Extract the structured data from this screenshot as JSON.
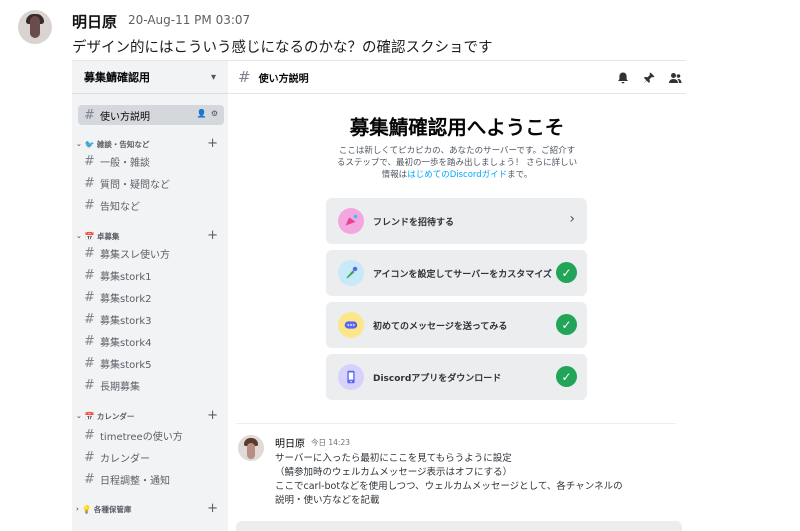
{
  "outer_message": {
    "author": "明日原",
    "timestamp": "20-Aug-11 PM 03:07",
    "text": "デザイン的にはこういう感じになるのかな？の確認スクショです"
  },
  "sidebar": {
    "server_name": "募集鯖確認用",
    "top_channel": "使い方説明",
    "categories": [
      {
        "name": "雑談・告知など",
        "emoji": "🐦",
        "channels": [
          "一般・雑談",
          "質問・疑問など",
          "告知など"
        ]
      },
      {
        "name": "卓募集",
        "emoji": "📅",
        "channels": [
          "募集スレ使い方",
          "募集stork1",
          "募集stork2",
          "募集stork3",
          "募集stork4",
          "募集stork5",
          "長期募集"
        ]
      },
      {
        "name": "カレンダー",
        "emoji": "📅",
        "channels": [
          "timetreeの使い方",
          "カレンダー",
          "日程調整・通知"
        ]
      },
      {
        "name": "各種保管庫",
        "emoji": "💡",
        "channels": []
      }
    ]
  },
  "main": {
    "channel_title": "使い方説明",
    "welcome_title": "募集鯖確認用へようこそ",
    "intro_line1": "ここは新しくてピカピカの、あなたのサーバーです。ご紹介す",
    "intro_line2": "るステップで、最初の一歩を踏み出しましょう！ さらに詳しい",
    "intro_prefix": "情報は",
    "intro_link": "はじめてのDiscordガイド",
    "intro_suffix": "まで。",
    "cards": [
      {
        "label": "フレンドを招待する",
        "icon": "invite-friends-icon",
        "done": false
      },
      {
        "label": "アイコンを設定してサーバーをカスタマイズ",
        "icon": "customize-server-icon",
        "done": true
      },
      {
        "label": "初めてのメッセージを送ってみる",
        "icon": "first-message-icon",
        "done": true
      },
      {
        "label": "Discordアプリをダウンロード",
        "icon": "download-app-icon",
        "done": true
      }
    ],
    "message": {
      "author": "明日原",
      "time": "今日 14:23",
      "lines": [
        "サーバーに入ったら最初にここを見てもらうように設定",
        "（鯖参加時のウェルカムメッセージ表示はオフにする）",
        "ここでcarl-botなどを使用しつつ、ウェルカムメッセージとして、各チャンネルの",
        "説明・使い方などを記載"
      ]
    }
  },
  "colors": {
    "accent_link": "#00a8fc",
    "check_green": "#23a559",
    "sidebar_bg": "#f2f3f5",
    "card_bg": "#ebedef"
  }
}
